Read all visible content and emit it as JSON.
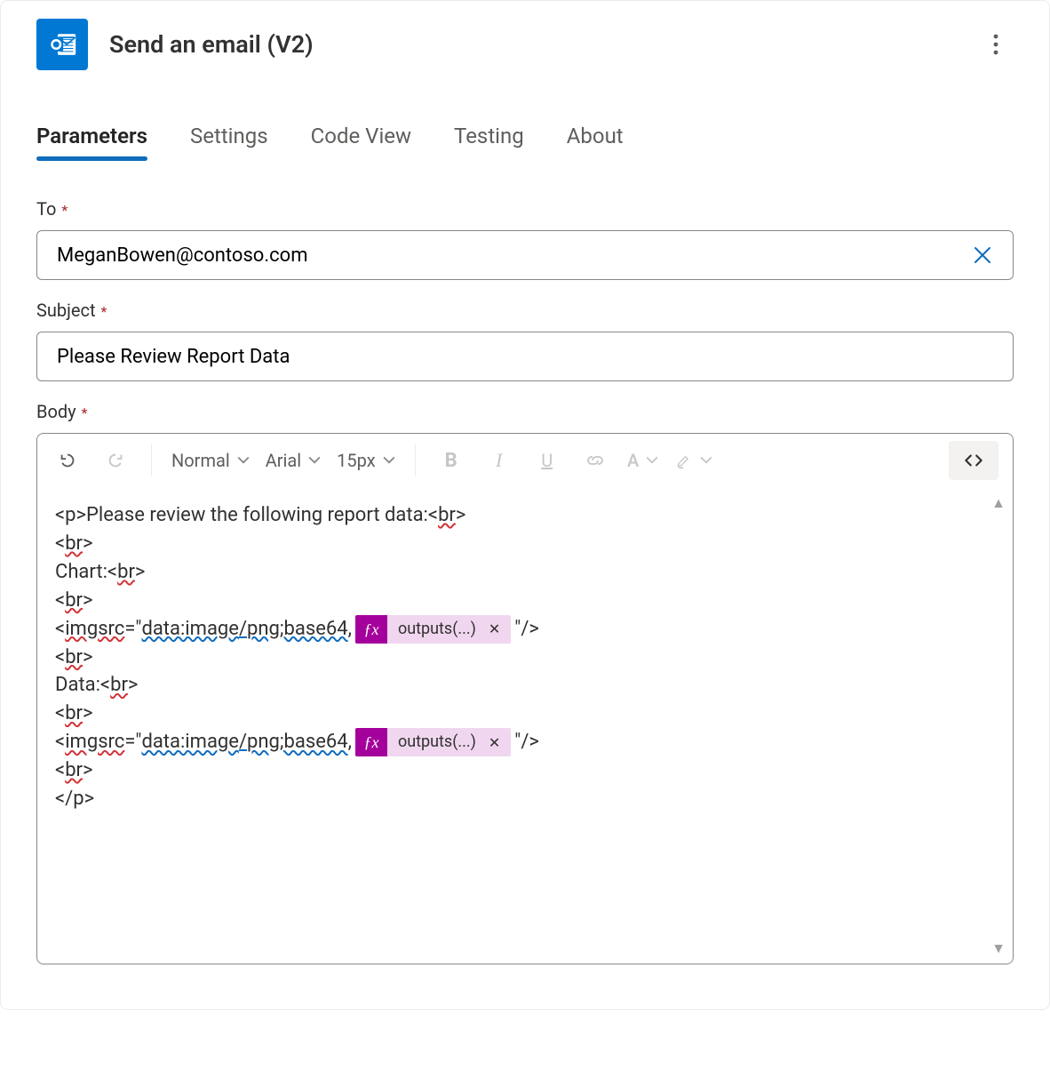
{
  "header": {
    "title": "Send an email (V2)"
  },
  "tabs": [
    {
      "id": "parameters",
      "label": "Parameters",
      "active": true
    },
    {
      "id": "settings",
      "label": "Settings",
      "active": false
    },
    {
      "id": "codeview",
      "label": "Code View",
      "active": false
    },
    {
      "id": "testing",
      "label": "Testing",
      "active": false
    },
    {
      "id": "about",
      "label": "About",
      "active": false
    }
  ],
  "fields": {
    "to": {
      "label": "To",
      "required": true,
      "value": "MeganBowen@contoso.com"
    },
    "subject": {
      "label": "Subject",
      "required": true,
      "value": "Please Review Report Data"
    },
    "body": {
      "label": "Body",
      "required": true
    }
  },
  "toolbar": {
    "paragraph": "Normal",
    "font": "Arial",
    "size": "15px"
  },
  "body_content": {
    "line1": "<p>Please review the following report data:<",
    "br": "br",
    "close": ">",
    "open": "<",
    "chart_label": "Chart:<",
    "img_prefix_a": "<",
    "img_word": "img",
    "space": " ",
    "src_word": "src",
    "eq": "=\"",
    "data_seg": "data:image",
    "slash": "/",
    "png_seg": "png;base64",
    "comma": ",",
    "token_label": "outputs(...)",
    "tail": "\"/>",
    "data_label": "Data:<",
    "endp": "</p>"
  }
}
